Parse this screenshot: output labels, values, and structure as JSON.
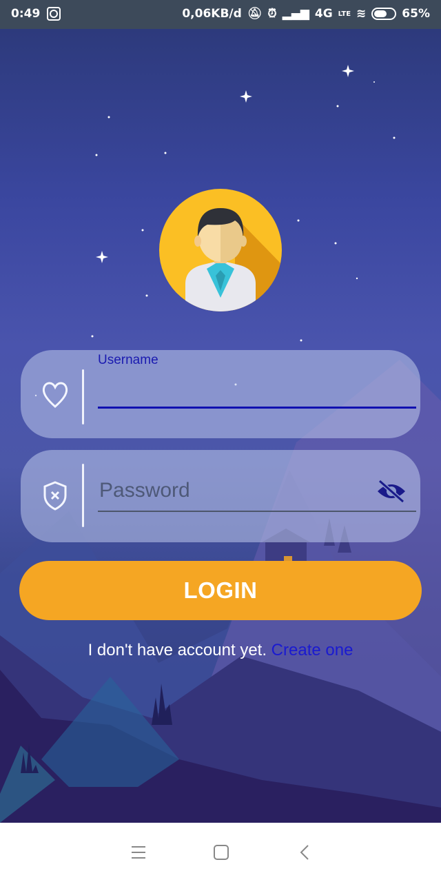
{
  "status_bar": {
    "time": "0:49",
    "data_speed": "0,06KB/d",
    "network": "4G",
    "volte": "LTE",
    "battery": "65%"
  },
  "login_form": {
    "username_label": "Username",
    "username_value": "",
    "password_placeholder": "Password",
    "login_label": "LOGIN",
    "no_account_text": "I don't have account yet. ",
    "create_link": "Create one"
  },
  "colors": {
    "accent": "#f5a623",
    "link": "#1a1ad0",
    "field_line": "#1010b0"
  },
  "icons": [
    "heart-icon",
    "shield-icon",
    "eye-off-icon",
    "avatar-icon",
    "menu-icon",
    "home-icon",
    "back-icon"
  ]
}
